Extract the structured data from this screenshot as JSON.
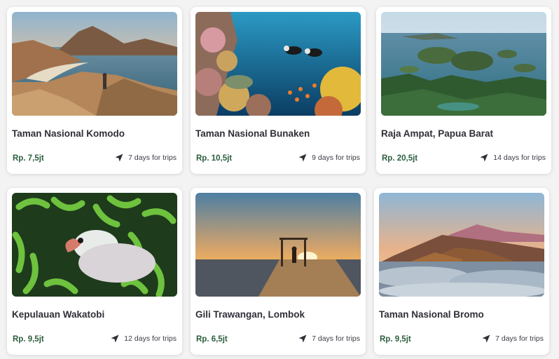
{
  "destinations": [
    {
      "title": "Taman Nasional Komodo",
      "price": "Rp. 7,5jt",
      "duration": "7 days for trips",
      "photo_icon": "komodo-island-photo"
    },
    {
      "title": "Taman Nasional Bunaken",
      "price": "Rp. 10,5jt",
      "duration": "9 days for trips",
      "photo_icon": "coral-reef-divers-photo"
    },
    {
      "title": "Raja Ampat, Papua Barat",
      "price": "Rp. 20,5jt",
      "duration": "14 days for trips",
      "photo_icon": "island-archipelago-photo"
    },
    {
      "title": "Kepulauan Wakatobi",
      "price": "Rp. 9,5jt",
      "duration": "12 days for trips",
      "photo_icon": "clownfish-anemone-photo"
    },
    {
      "title": "Gili Trawangan, Lombok",
      "price": "Rp. 6,5jt",
      "duration": "7 days for trips",
      "photo_icon": "sunset-swing-photo"
    },
    {
      "title": "Taman Nasional Bromo",
      "price": "Rp. 9,5jt",
      "duration": "7 days for trips",
      "photo_icon": "volcano-sea-of-clouds-photo"
    }
  ],
  "colors": {
    "price": "#2b5e3d",
    "title": "#2f2f38",
    "card": "#ffffff",
    "background": "#f3f3f4"
  },
  "trip_icon": "navigation-arrow-icon"
}
